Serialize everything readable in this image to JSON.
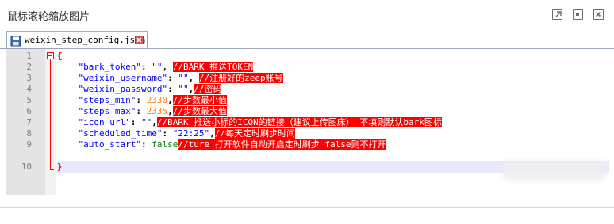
{
  "window": {
    "title": "鼠标滚轮缩放图片",
    "buttons": [
      "popout-icon",
      "restore-icon",
      "close-icon"
    ]
  },
  "tab": {
    "filename": "weixin_step_config.json",
    "icon": "save-file-icon",
    "close_icon": "tab-close-icon"
  },
  "editor": {
    "line_numbers": [
      "1",
      "2",
      "3",
      "4",
      "5",
      "6",
      "7",
      "8",
      "9",
      "10"
    ],
    "lines": [
      {
        "open": "{"
      },
      {
        "key": "\"bark_token\"",
        "sep": ": ",
        "value": "\"\"",
        "tail": ", ",
        "comment": "//BARK 推送TOKEN"
      },
      {
        "key": "\"weixin_username\"",
        "sep": ": ",
        "value": "\"\"",
        "tail": ", ",
        "comment": "//注册好的zeep账号"
      },
      {
        "key": "\"weixin_password\"",
        "sep": ": ",
        "value": "\"\"",
        "tail": ",",
        "comment": "//密码"
      },
      {
        "key": "\"steps_min\"",
        "sep": ": ",
        "value": "2330",
        "tail": ",",
        "comment": "//步数最小值"
      },
      {
        "key": "\"steps_max\"",
        "sep": ": ",
        "value": "2335",
        "tail": ",",
        "comment": "//步数最大值"
      },
      {
        "key": "\"icon_url\"",
        "sep": ": ",
        "value": "\"\"",
        "tail": ",",
        "comment": "//BARK 推送小标的ICON的链接（建议上传图床） 不填则默认bark图标"
      },
      {
        "key": "\"scheduled_time\"",
        "sep": ": ",
        "value": "\"22:25\"",
        "tail": ",",
        "comment": "//每天定时刷步时间"
      },
      {
        "key": "\"auto_start\"",
        "sep": ": ",
        "value": "false",
        "tail": "",
        "comment": "//ture 打开软件自动开启定时刷步 false则不打开"
      },
      {
        "close": "}"
      }
    ]
  },
  "colors": {
    "key": "#0000ff",
    "number": "#ff8000",
    "literal": "#008000",
    "comment_bg": "#ff0000",
    "tab_accent": "#f5a623"
  }
}
